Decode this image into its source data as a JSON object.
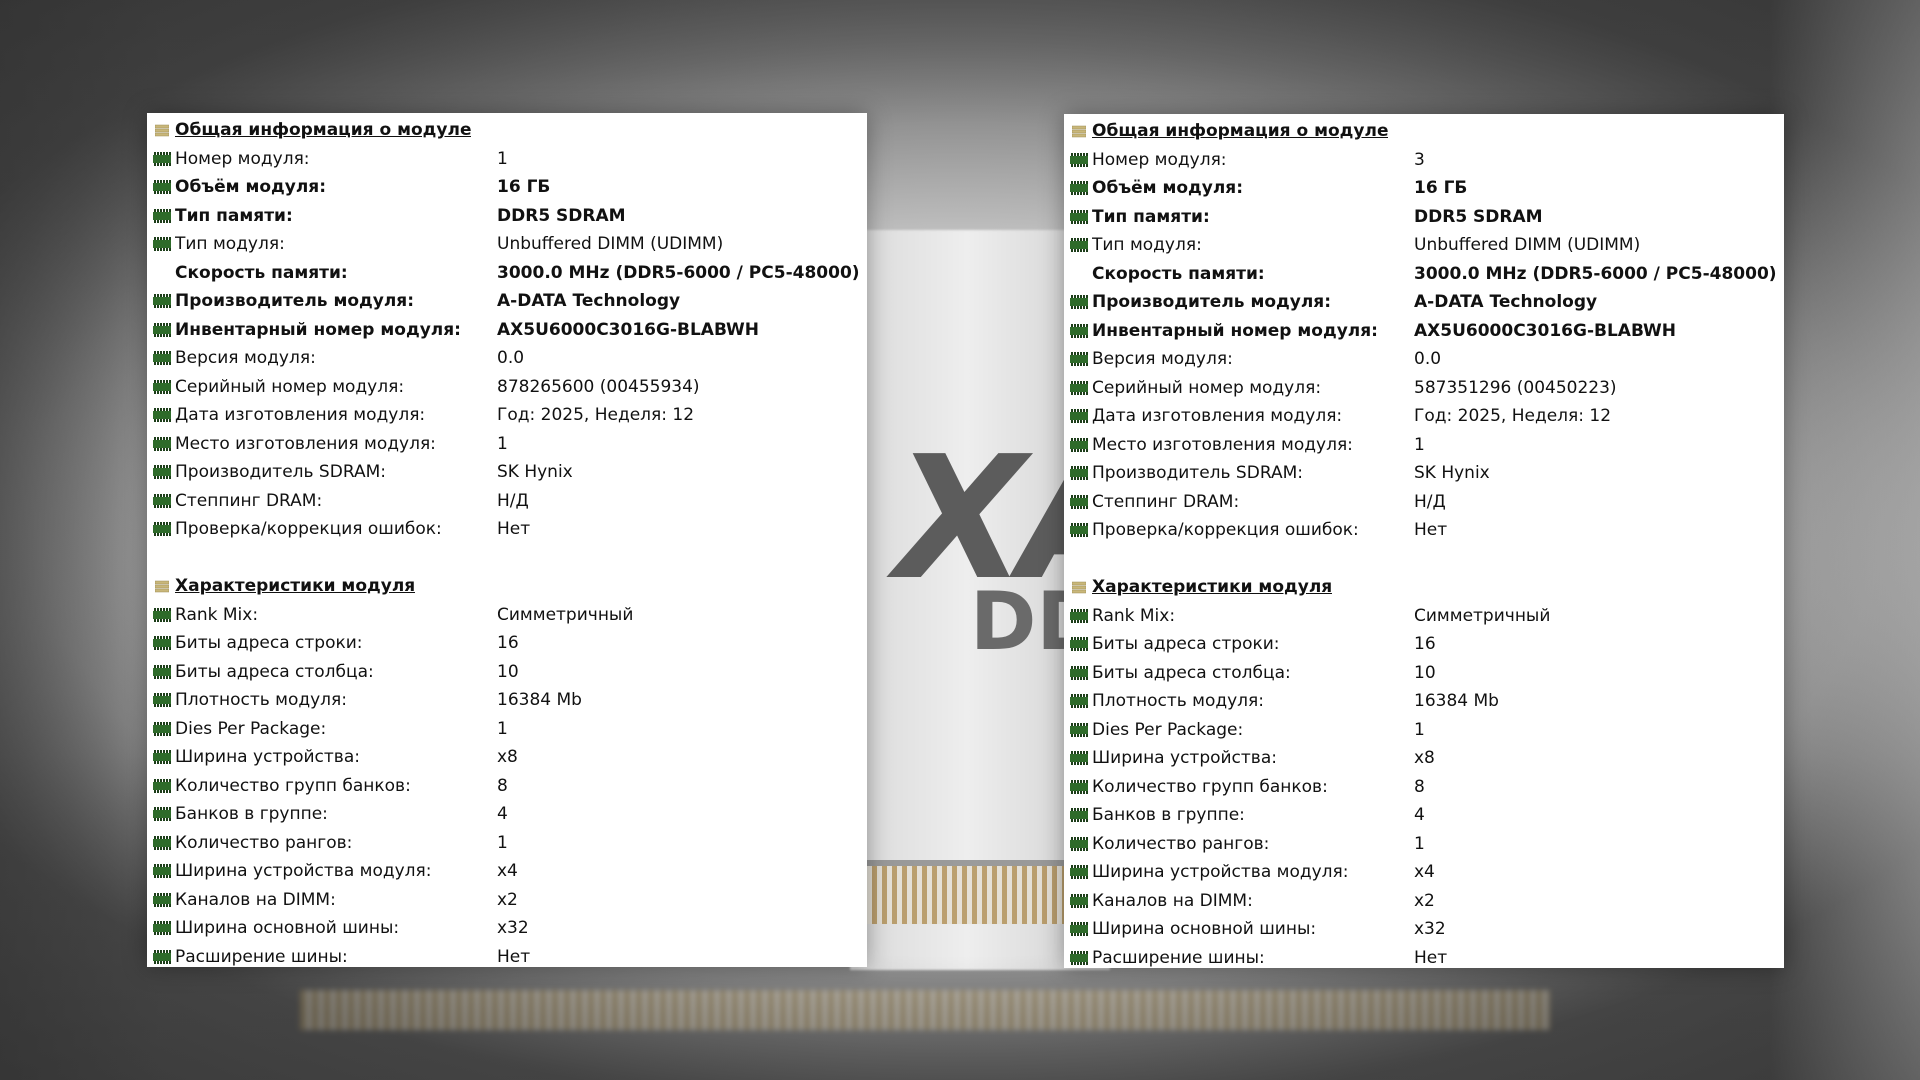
{
  "background": {
    "brand_text": "XA",
    "type_text": "DD"
  },
  "panels": [
    {
      "sections": [
        {
          "title": "Общая информация о модуле",
          "rows": [
            {
              "label": "Номер модуля:",
              "value": "1",
              "bold": false,
              "icon": "memory-chip-icon"
            },
            {
              "label": "Объём модуля:",
              "value": "16 ГБ",
              "bold": true,
              "icon": "memory-chip-icon"
            },
            {
              "label": "Тип памяти:",
              "value": "DDR5 SDRAM",
              "bold": true,
              "icon": "memory-chip-icon"
            },
            {
              "label": "Тип модуля:",
              "value": "Unbuffered DIMM (UDIMM)",
              "bold": false,
              "icon": "memory-chip-icon"
            },
            {
              "label": "Скорость памяти:",
              "value": "3000.0 MHz (DDR5-6000 / PC5-48000)",
              "bold": true,
              "icon": "none"
            },
            {
              "label": "Производитель модуля:",
              "value": "A-DATA Technology",
              "bold": true,
              "icon": "memory-chip-icon"
            },
            {
              "label": "Инвентарный номер модуля:",
              "value": "AX5U6000C3016G-BLABWH",
              "bold": true,
              "icon": "memory-chip-icon"
            },
            {
              "label": "Версия модуля:",
              "value": "0.0",
              "bold": false,
              "icon": "memory-chip-icon"
            },
            {
              "label": "Серийный номер модуля:",
              "value": "878265600 (00455934)",
              "bold": false,
              "icon": "memory-chip-icon"
            },
            {
              "label": "Дата изготовления модуля:",
              "value": "Год: 2025, Неделя: 12",
              "bold": false,
              "icon": "memory-chip-icon"
            },
            {
              "label": "Место изготовления модуля:",
              "value": "1",
              "bold": false,
              "icon": "memory-chip-icon"
            },
            {
              "label": "Производитель SDRAM:",
              "value": "SK Hynix",
              "bold": false,
              "icon": "memory-chip-icon"
            },
            {
              "label": "Степпинг DRAM:",
              "value": "Н/Д",
              "bold": false,
              "icon": "memory-chip-icon"
            },
            {
              "label": "Проверка/коррекция ошибок:",
              "value": "Нет",
              "bold": false,
              "icon": "memory-chip-icon"
            }
          ]
        },
        {
          "title": "Характеристики модуля",
          "rows": [
            {
              "label": "Rank Mix:",
              "value": "Симметричный",
              "bold": false,
              "icon": "memory-chip-icon"
            },
            {
              "label": "Биты адреса строки:",
              "value": "16",
              "bold": false,
              "icon": "memory-chip-icon"
            },
            {
              "label": "Биты адреса столбца:",
              "value": "10",
              "bold": false,
              "icon": "memory-chip-icon"
            },
            {
              "label": "Плотность модуля:",
              "value": "16384 Mb",
              "bold": false,
              "icon": "memory-chip-icon"
            },
            {
              "label": "Dies Per Package:",
              "value": "1",
              "bold": false,
              "icon": "memory-chip-icon"
            },
            {
              "label": "Ширина устройства:",
              "value": "x8",
              "bold": false,
              "icon": "memory-chip-icon"
            },
            {
              "label": "Количество групп банков:",
              "value": "8",
              "bold": false,
              "icon": "memory-chip-icon"
            },
            {
              "label": "Банков в группе:",
              "value": "4",
              "bold": false,
              "icon": "memory-chip-icon"
            },
            {
              "label": "Количество рангов:",
              "value": "1",
              "bold": false,
              "icon": "memory-chip-icon"
            },
            {
              "label": "Ширина устройства модуля:",
              "value": "x4",
              "bold": false,
              "icon": "memory-chip-icon"
            },
            {
              "label": "Каналов на DIMM:",
              "value": "x2",
              "bold": false,
              "icon": "memory-chip-icon"
            },
            {
              "label": "Ширина основной шины:",
              "value": "x32",
              "bold": false,
              "icon": "memory-chip-icon"
            },
            {
              "label": "Расширение шины:",
              "value": "Нет",
              "bold": false,
              "icon": "memory-chip-icon"
            }
          ]
        }
      ]
    },
    {
      "sections": [
        {
          "title": "Общая информация о модуле",
          "rows": [
            {
              "label": "Номер модуля:",
              "value": "3",
              "bold": false,
              "icon": "memory-chip-icon"
            },
            {
              "label": "Объём модуля:",
              "value": "16 ГБ",
              "bold": true,
              "icon": "memory-chip-icon"
            },
            {
              "label": "Тип памяти:",
              "value": "DDR5 SDRAM",
              "bold": true,
              "icon": "memory-chip-icon"
            },
            {
              "label": "Тип модуля:",
              "value": "Unbuffered DIMM (UDIMM)",
              "bold": false,
              "icon": "memory-chip-icon"
            },
            {
              "label": "Скорость памяти:",
              "value": "3000.0 MHz (DDR5-6000 / PC5-48000)",
              "bold": true,
              "icon": "none"
            },
            {
              "label": "Производитель модуля:",
              "value": "A-DATA Technology",
              "bold": true,
              "icon": "memory-chip-icon"
            },
            {
              "label": "Инвентарный номер модуля:",
              "value": "AX5U6000C3016G-BLABWH",
              "bold": true,
              "icon": "memory-chip-icon"
            },
            {
              "label": "Версия модуля:",
              "value": "0.0",
              "bold": false,
              "icon": "memory-chip-icon"
            },
            {
              "label": "Серийный номер модуля:",
              "value": "587351296 (00450223)",
              "bold": false,
              "icon": "memory-chip-icon"
            },
            {
              "label": "Дата изготовления модуля:",
              "value": "Год: 2025, Неделя: 12",
              "bold": false,
              "icon": "memory-chip-icon"
            },
            {
              "label": "Место изготовления модуля:",
              "value": "1",
              "bold": false,
              "icon": "memory-chip-icon"
            },
            {
              "label": "Производитель SDRAM:",
              "value": "SK Hynix",
              "bold": false,
              "icon": "memory-chip-icon"
            },
            {
              "label": "Степпинг DRAM:",
              "value": "Н/Д",
              "bold": false,
              "icon": "memory-chip-icon"
            },
            {
              "label": "Проверка/коррекция ошибок:",
              "value": "Нет",
              "bold": false,
              "icon": "memory-chip-icon"
            }
          ]
        },
        {
          "title": "Характеристики модуля",
          "rows": [
            {
              "label": "Rank Mix:",
              "value": "Симметричный",
              "bold": false,
              "icon": "memory-chip-icon"
            },
            {
              "label": "Биты адреса строки:",
              "value": "16",
              "bold": false,
              "icon": "memory-chip-icon"
            },
            {
              "label": "Биты адреса столбца:",
              "value": "10",
              "bold": false,
              "icon": "memory-chip-icon"
            },
            {
              "label": "Плотность модуля:",
              "value": "16384 Mb",
              "bold": false,
              "icon": "memory-chip-icon"
            },
            {
              "label": "Dies Per Package:",
              "value": "1",
              "bold": false,
              "icon": "memory-chip-icon"
            },
            {
              "label": "Ширина устройства:",
              "value": "x8",
              "bold": false,
              "icon": "memory-chip-icon"
            },
            {
              "label": "Количество групп банков:",
              "value": "8",
              "bold": false,
              "icon": "memory-chip-icon"
            },
            {
              "label": "Банков в группе:",
              "value": "4",
              "bold": false,
              "icon": "memory-chip-icon"
            },
            {
              "label": "Количество рангов:",
              "value": "1",
              "bold": false,
              "icon": "memory-chip-icon"
            },
            {
              "label": "Ширина устройства модуля:",
              "value": "x4",
              "bold": false,
              "icon": "memory-chip-icon"
            },
            {
              "label": "Каналов на DIMM:",
              "value": "x2",
              "bold": false,
              "icon": "memory-chip-icon"
            },
            {
              "label": "Ширина основной шины:",
              "value": "x32",
              "bold": false,
              "icon": "memory-chip-icon"
            },
            {
              "label": "Расширение шины:",
              "value": "Нет",
              "bold": false,
              "icon": "memory-chip-icon"
            }
          ]
        }
      ]
    }
  ],
  "colors": {
    "chip_icon": "#2e6b2a",
    "chip_icon_pins": "#1c3d19",
    "section_icon": "#c9b77a",
    "panel_background": "#ffffff",
    "text": "#111111"
  }
}
